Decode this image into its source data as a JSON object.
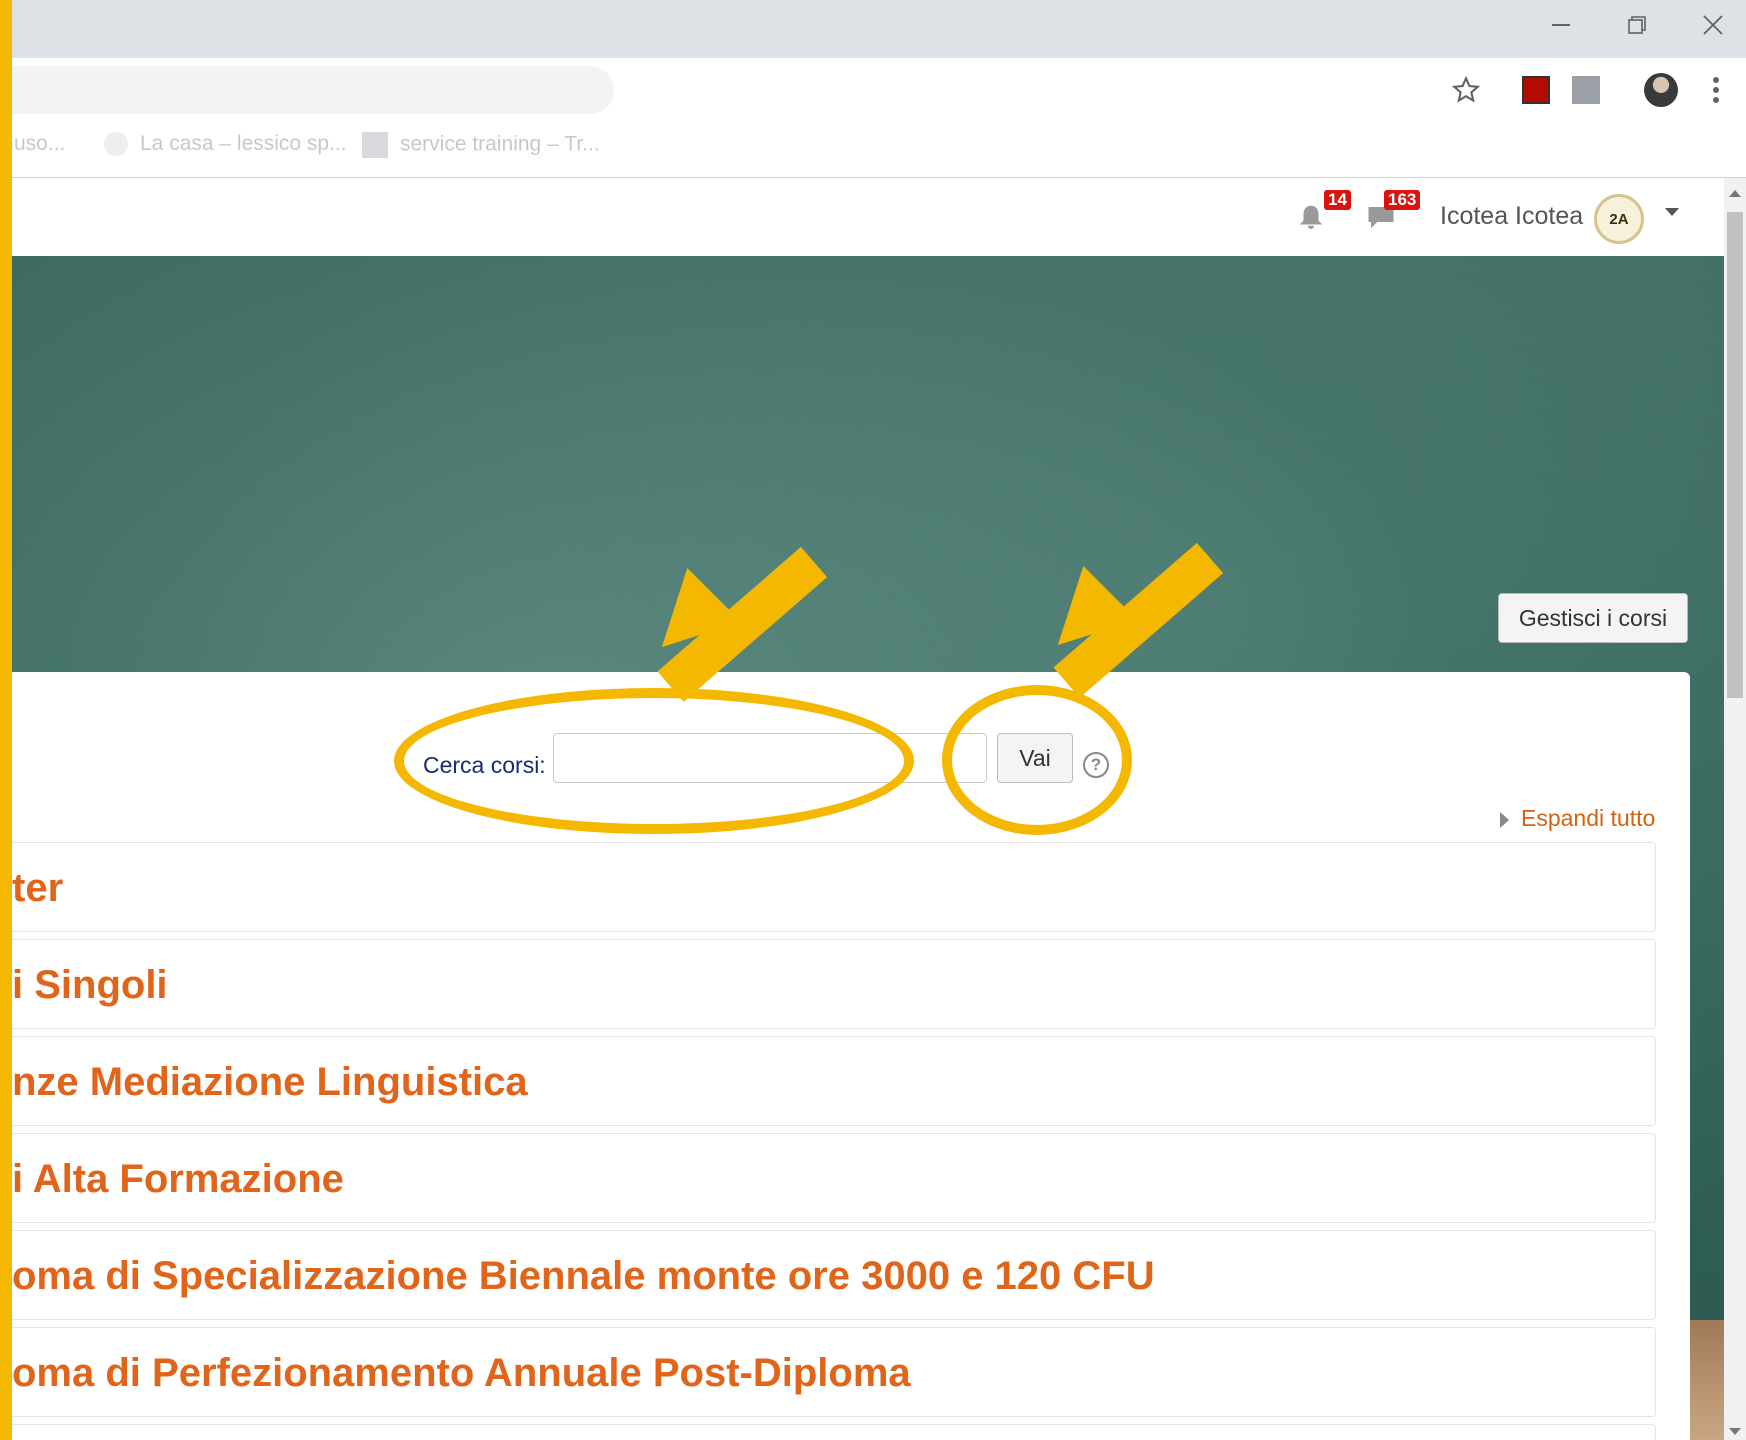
{
  "browser": {
    "bookmarks": [
      {
        "label": "uso..."
      },
      {
        "label": "La casa – lessico sp..."
      },
      {
        "label": "service training – Tr..."
      }
    ]
  },
  "navbar": {
    "notifications_count": "14",
    "messages_count": "163",
    "user_name": "Icotea Icotea",
    "avatar_text": "2A"
  },
  "hero": {
    "manage_courses_label": "Gestisci i corsi"
  },
  "search": {
    "label": "Cerca corsi:",
    "value": "",
    "go_label": "Vai",
    "help_symbol": "?"
  },
  "expand_all_label": "Espandi tutto",
  "categories": [
    {
      "title": "ter"
    },
    {
      "title": "i Singoli"
    },
    {
      "title": "nze Mediazione Linguistica"
    },
    {
      "title": "i Alta Formazione"
    },
    {
      "title": "oma di Specializzazione Biennale monte ore 3000 e 120 CFU"
    },
    {
      "title": "oma di Perfezionamento Annuale Post-Diploma"
    }
  ],
  "colors": {
    "accent_orange": "#e0651a",
    "annotation_yellow": "#f5b800",
    "badge_red": "#d9140f",
    "chalkboard_green": "#35655b"
  }
}
